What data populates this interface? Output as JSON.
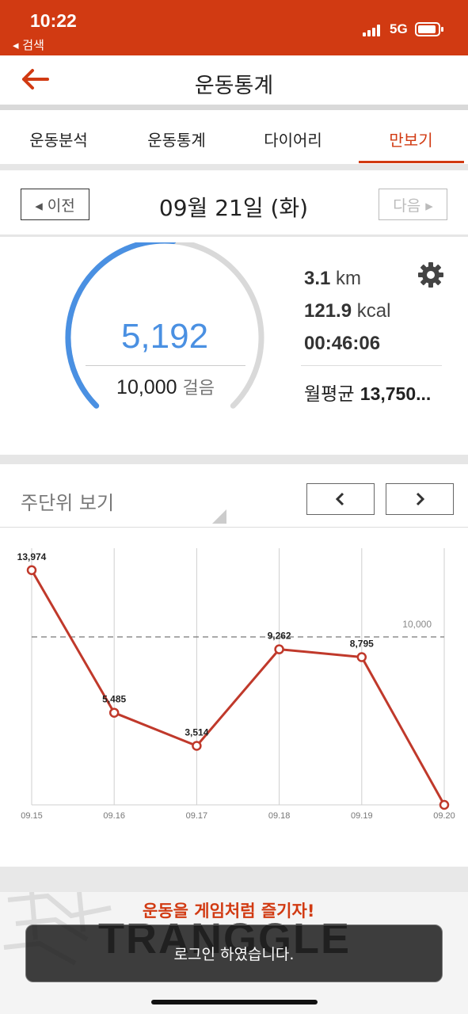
{
  "status_bar": {
    "time": "10:22",
    "back_label": "◂ 검색",
    "network": "5G"
  },
  "header": {
    "title": "운동통계"
  },
  "tabs": [
    {
      "label": "운동분석",
      "active": false
    },
    {
      "label": "운동통계",
      "active": false
    },
    {
      "label": "다이어리",
      "active": false
    },
    {
      "label": "만보기",
      "active": true
    }
  ],
  "date_nav": {
    "prev_label": "◂ 이전",
    "date": "09월 21일 (화)",
    "next_label": "다음 ▸"
  },
  "summary": {
    "steps": "5,192",
    "goal": "10,000",
    "goal_unit": "걸음",
    "progress": 0.5192,
    "distance_value": "3.1",
    "distance_unit": "km",
    "calories_value": "121.9",
    "calories_unit": "kcal",
    "duration": "00:46:06",
    "monthly_label": "월평균",
    "monthly_value": "13,750..."
  },
  "weekly": {
    "label": "주단위 보기"
  },
  "chart_data": {
    "type": "line",
    "x": [
      "09.15",
      "09.16",
      "09.17",
      "09.18",
      "09.19",
      "09.20"
    ],
    "series": [
      {
        "values": [
          13974,
          5485,
          3514,
          9262,
          8795,
          0
        ]
      }
    ],
    "data_labels": [
      "13,974",
      "5,485",
      "3,514",
      "9,262",
      "8,795",
      ""
    ],
    "goal_line": {
      "value": 10000,
      "label": "10,000"
    },
    "ylim": [
      0,
      15000
    ],
    "grid": true,
    "line_color": "#c0392b"
  },
  "banner": {
    "slogan": "운동을 게임처럼 즐기자!",
    "logo_text": "TRANGGLE"
  },
  "toast": {
    "message": "로그인 하였습니다."
  },
  "colors": {
    "brand": "#d13a12",
    "progress": "#4a90e2",
    "track": "#d9d9d9"
  }
}
